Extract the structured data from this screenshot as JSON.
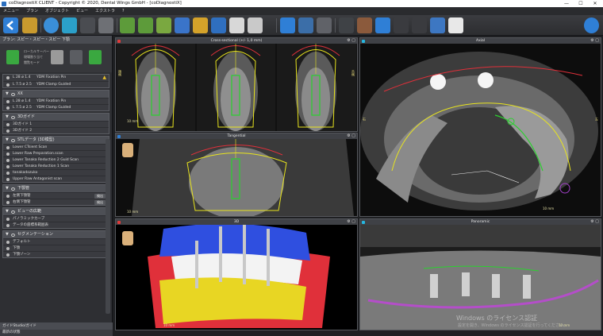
{
  "window": {
    "title": "coDiagnostiX CLIENT - Copyright © 2020, Dental Wings GmbH - [coDiagnostiX]",
    "min": "—",
    "max": "☐",
    "close": "✕"
  },
  "menu": [
    "メニュー",
    "プラン",
    "オブジェクト",
    "ビュー",
    "エクストラ",
    "?"
  ],
  "toolbar": {
    "icons": [
      "back-icon",
      "open-folder-icon",
      "globe-icon",
      "document-icon",
      "print-icon",
      "shield-icon",
      "implant-add-icon",
      "implant-edit-icon",
      "implant-copy-icon",
      "implant-pin-icon",
      "sleeve-icon",
      "abutment-icon",
      "bone-icon",
      "guide-icon",
      "ruler-icon",
      "snap-icon",
      "measure-icon",
      "crosshair-icon",
      "cursor-icon",
      "layout-icon",
      "scan-icon",
      "undo-icon",
      "redo-icon",
      "syringe-icon",
      "tooth-icon",
      "help-icon"
    ]
  },
  "left_panel": {
    "header": "プラン: スピー・スピー・スピー 下顎",
    "action_labels": [
      "ローカルサーバー",
      "現場割り当て",
      "閲覧モード"
    ],
    "groups": [
      {
        "title": "",
        "rows": [
          {
            "size": "L 28 ø 1.4",
            "name": "YDM Fixation Pin",
            "warn": true
          },
          {
            "size": "L 7.5 ø 2.5",
            "name": "YDM Clamp Guided",
            "warn": false
          }
        ]
      },
      {
        "title": "XX",
        "rows": [
          {
            "size": "L 28 ø 1.4",
            "name": "YDM Fixation Pin",
            "warn": false
          },
          {
            "size": "L 7.5 ø 2.5",
            "name": "YDM Clamp Guided",
            "warn": false
          }
        ]
      },
      {
        "title": "3Dガイド",
        "rows": [
          {
            "size": "3Dガイド 1",
            "name": "",
            "warn": false
          },
          {
            "size": "3Dガイド 2",
            "name": "",
            "warn": false
          }
        ]
      },
      {
        "title": "STLデータ (3D模型)",
        "rows": [
          {
            "size": "Lower CTsient Scan",
            "name": "",
            "warn": false
          },
          {
            "size": "Lower Raw Preparation.scan",
            "name": "",
            "warn": false
          },
          {
            "size": "Lower Tanaka Reduction 2 Guid Scan",
            "name": "",
            "warn": false
          },
          {
            "size": "Lower Tanaka Reduction 1 Scan",
            "name": "",
            "warn": false
          },
          {
            "size": "tanakadozuko",
            "name": "",
            "warn": false
          },
          {
            "size": "Upper Raw Antagonist scan",
            "name": "",
            "warn": false
          }
        ]
      },
      {
        "title": "下顎管",
        "rows": [
          {
            "size": "左側下顎管",
            "name": "",
            "btn": "検出"
          },
          {
            "size": "右側下顎管",
            "name": "",
            "btn": "検出"
          }
        ]
      },
      {
        "title": "ビューの広範",
        "rows": [
          {
            "size": "パノラミックカーブ",
            "name": ""
          },
          {
            "size": "データの座標系範囲表",
            "name": ""
          }
        ]
      },
      {
        "title": "セグメンテーション",
        "rows": [
          {
            "size": "デフォルト",
            "name": ""
          },
          {
            "size": "下顎",
            "name": ""
          },
          {
            "size": "下顎ゾーン",
            "name": ""
          }
        ]
      }
    ],
    "bottom1": "ガイドStudio/ガイド",
    "bottom2": "最新の状態"
  },
  "viewports": {
    "cross": {
      "title": "Cross-sectional (+/- 1,0 mm)",
      "scale": "10 mm",
      "side_left": "頬側",
      "side_right": "舌側"
    },
    "axial": {
      "title": "Axial",
      "scale": "10 mm",
      "side_left": "右",
      "side_right": "左"
    },
    "tangential": {
      "title": "Tangential",
      "scale": "10 mm"
    },
    "view3d": {
      "title": "3D",
      "scale": "10 mm"
    },
    "panoramic": {
      "title": "Panoramic",
      "scale": "10 mm"
    }
  },
  "watermark": {
    "line1": "Windows のライセンス認証",
    "line2": "設定を開き、Windows のライセンス認証を行ってください。"
  },
  "colors": {
    "accent": "#2f7fd6",
    "yellow": "#e8e41e",
    "red": "#e0303a",
    "green": "#2ad12e"
  }
}
